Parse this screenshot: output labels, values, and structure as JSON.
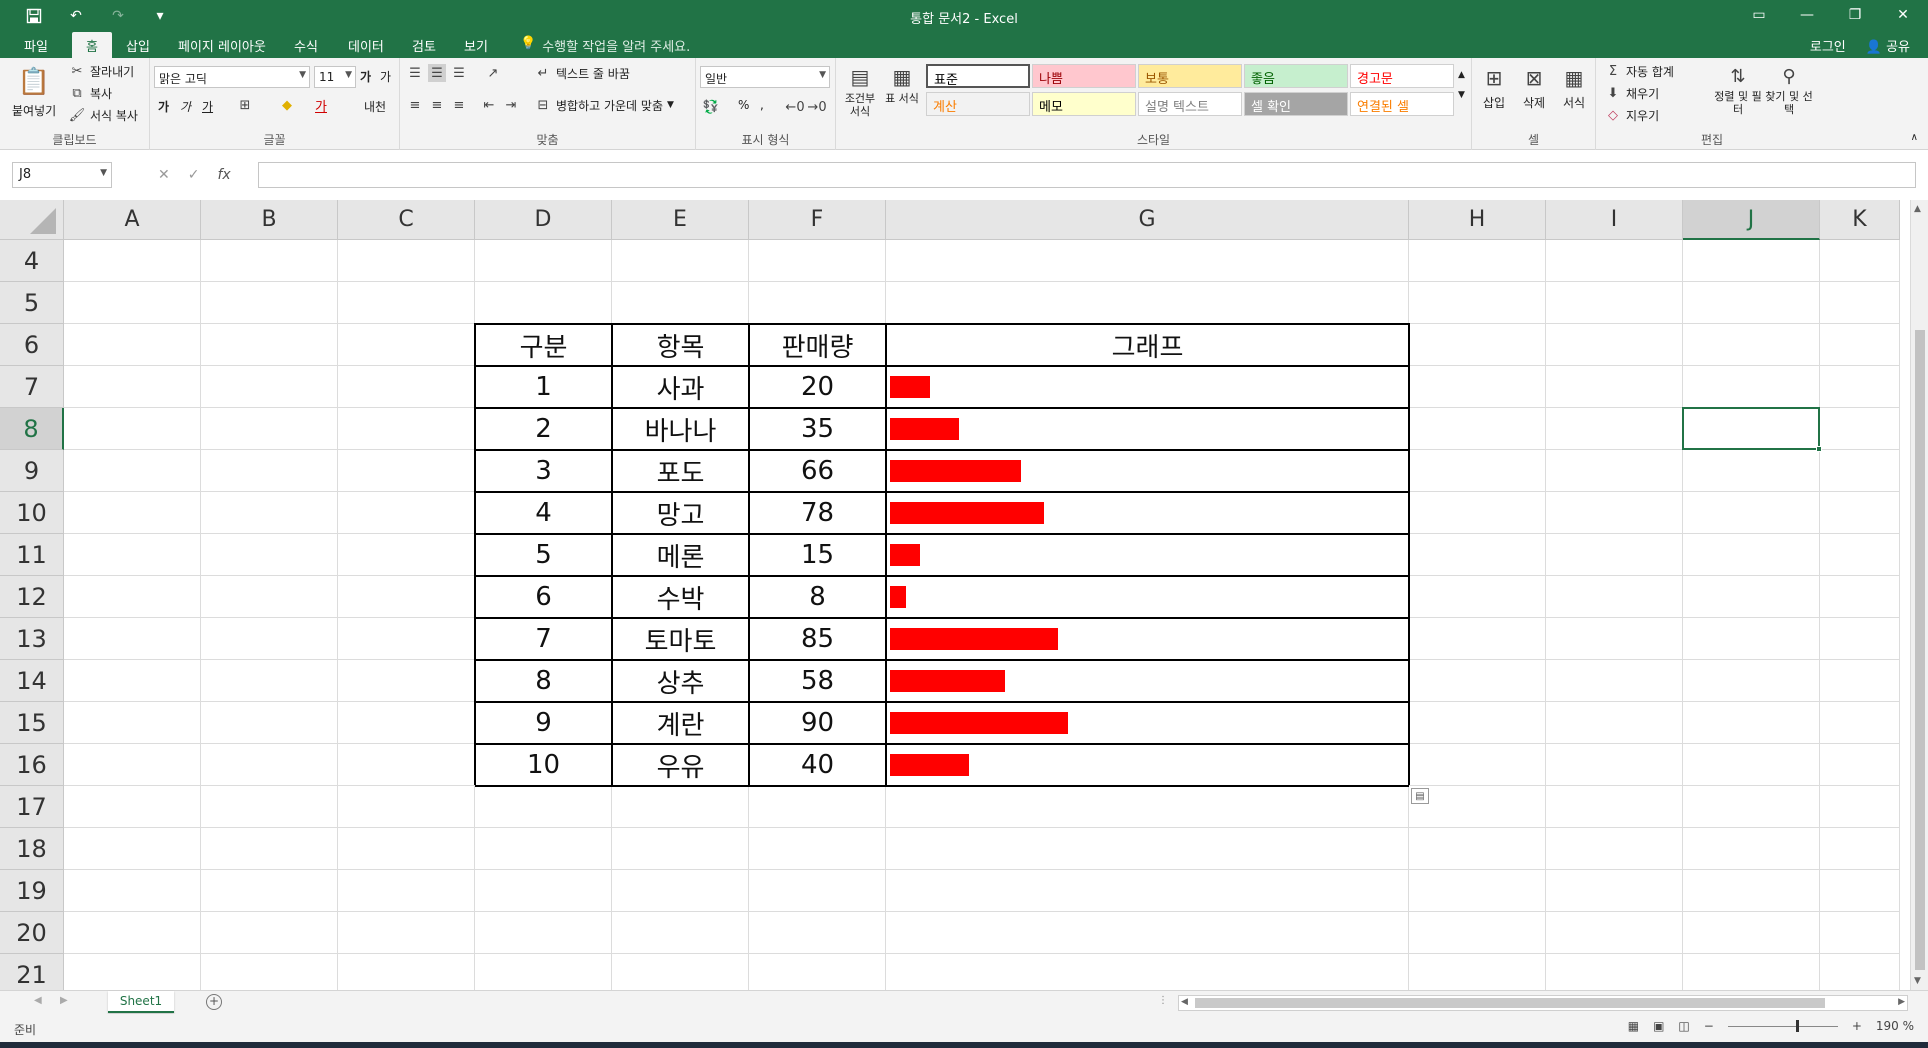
{
  "app": {
    "title": "통합 문서2 - Excel",
    "accent": "#217346"
  },
  "tabs": [
    {
      "label": "파일"
    },
    {
      "label": "홈"
    },
    {
      "label": "삽입"
    },
    {
      "label": "페이지 레이아웃"
    },
    {
      "label": "수식"
    },
    {
      "label": "데이터"
    },
    {
      "label": "검토"
    },
    {
      "label": "보기"
    }
  ],
  "tell_me": "수행할 작업을 알려 주세요.",
  "account": {
    "login": "로그인",
    "share": "공유"
  },
  "ribbon": {
    "clipboard": {
      "label": "클립보드",
      "paste": "붙여넣기",
      "cut": "잘라내기",
      "copy": "복사",
      "format_painter": "서식 복사"
    },
    "font": {
      "label": "글꼴",
      "name": "맑은 고딕",
      "size": "11",
      "bold": "가",
      "italic": "가",
      "underline": "가",
      "grow": "가",
      "shrink": "가",
      "phonetic": "내천"
    },
    "alignment": {
      "label": "맞춤",
      "wrap": "텍스트 줄 바꿈",
      "merge": "병합하고 가운데 맞춤"
    },
    "number": {
      "label": "표시 형식",
      "format": "일반",
      "percent": "%",
      "comma": ","
    },
    "styles": {
      "label": "스타일",
      "conditional": "조건부 서식",
      "table": "표 서식",
      "cells": [
        {
          "label": "표준",
          "bg": "#ffffff",
          "fg": "#000000"
        },
        {
          "label": "나쁨",
          "bg": "#ffc7ce",
          "fg": "#9c0006"
        },
        {
          "label": "보통",
          "bg": "#ffeb9c",
          "fg": "#9c5700"
        },
        {
          "label": "좋음",
          "bg": "#c6efce",
          "fg": "#006100"
        },
        {
          "label": "경고문",
          "bg": "#ffffff",
          "fg": "#ff0000"
        },
        {
          "label": "계산",
          "bg": "#f2f2f2",
          "fg": "#fa7d00"
        },
        {
          "label": "메모",
          "bg": "#ffffcc",
          "fg": "#000000"
        },
        {
          "label": "설명 텍스트",
          "bg": "#ffffff",
          "fg": "#7f7f7f"
        },
        {
          "label": "셀 확인",
          "bg": "#a5a5a5",
          "fg": "#ffffff"
        },
        {
          "label": "연결된 셀",
          "bg": "#ffffff",
          "fg": "#fa7d00"
        }
      ]
    },
    "cells": {
      "label": "셀",
      "insert": "삽입",
      "delete": "삭제",
      "format": "서식"
    },
    "editing": {
      "label": "편집",
      "autosum": "자동 합계",
      "fill": "채우기",
      "clear": "지우기",
      "sort": "정렬 및 필터",
      "find": "찾기 및 선택"
    }
  },
  "formula_bar": {
    "name_box": "J8",
    "fx": "fx",
    "value": ""
  },
  "columns": [
    "A",
    "B",
    "C",
    "D",
    "E",
    "F",
    "G",
    "H",
    "I",
    "J",
    "K"
  ],
  "rows": [
    "4",
    "5",
    "6",
    "7",
    "8",
    "9",
    "10",
    "11",
    "12",
    "13",
    "14",
    "15",
    "16",
    "17",
    "18",
    "19",
    "20",
    "21"
  ],
  "selected": {
    "column": "J",
    "row": "8"
  },
  "table": {
    "headers": [
      "구분",
      "항목",
      "판매량",
      "그래프"
    ],
    "rows": [
      {
        "no": "1",
        "item": "사과",
        "qty": "20"
      },
      {
        "no": "2",
        "item": "바나나",
        "qty": "35"
      },
      {
        "no": "3",
        "item": "포도",
        "qty": "66"
      },
      {
        "no": "4",
        "item": "망고",
        "qty": "78"
      },
      {
        "no": "5",
        "item": "메론",
        "qty": "15"
      },
      {
        "no": "6",
        "item": "수박",
        "qty": "8"
      },
      {
        "no": "7",
        "item": "토마토",
        "qty": "85"
      },
      {
        "no": "8",
        "item": "상추",
        "qty": "58"
      },
      {
        "no": "9",
        "item": "계란",
        "qty": "90"
      },
      {
        "no": "10",
        "item": "우유",
        "qty": "40"
      }
    ],
    "bar_color": "#ff0000"
  },
  "sheets": [
    {
      "label": "Sheet1"
    }
  ],
  "status": {
    "ready": "준비",
    "zoom": "190 %"
  }
}
